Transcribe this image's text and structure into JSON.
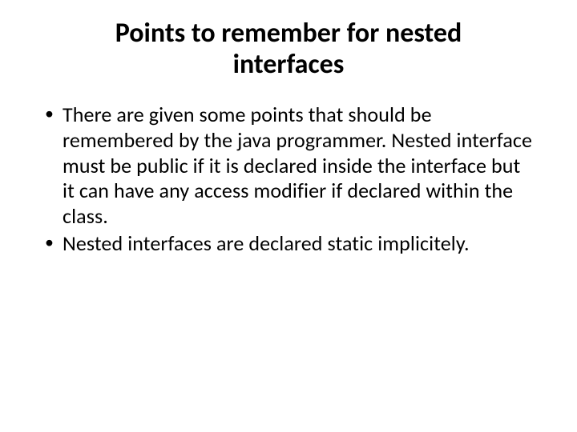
{
  "slide": {
    "title": "Points to remember for nested interfaces",
    "bullets": [
      "There are given some points that should be remembered by the java programmer. Nested interface must be public if it is declared inside the interface but it can have any access modifier if declared within the class.",
      "Nested interfaces are declared static implicitely."
    ]
  }
}
